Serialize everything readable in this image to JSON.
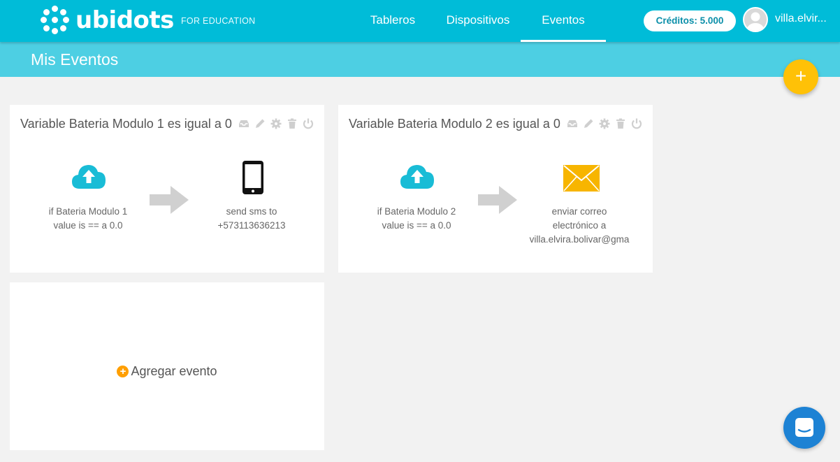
{
  "header": {
    "logo_text": "ubidots",
    "logo_sub": "FOR EDUCATION",
    "nav": [
      "Tableros",
      "Dispositivos",
      "Eventos"
    ],
    "active_nav": "Eventos",
    "credits": "Créditos: 5.000",
    "username": "villa.elvir..."
  },
  "page": {
    "title": "Mis Eventos"
  },
  "events": [
    {
      "title": "Variable Bateria Modulo 1 es igual a 0",
      "trigger_line1": "if Bateria Modulo 1",
      "trigger_line2": "value is == a 0.0",
      "action_icon": "phone-icon",
      "action_line1": "send sms to",
      "action_line2": "+573113636213"
    },
    {
      "title": "Variable Bateria Modulo 2 es igual a 0",
      "trigger_line1": "if Bateria Modulo 2",
      "trigger_line2": "value is == a 0.0",
      "action_icon": "envelope-icon",
      "action_line1": "enviar correo",
      "action_line2": "electrónico a",
      "action_line3": "villa.elvira.bolivar@gma"
    }
  ],
  "add_event": {
    "label": "Agregar evento"
  },
  "colors": {
    "primary": "#00bcd8",
    "subbar": "#4dcfe3",
    "accent_yellow": "#ffc107",
    "add_orange": "#ff9f00",
    "chat_blue": "#1d82d4"
  }
}
